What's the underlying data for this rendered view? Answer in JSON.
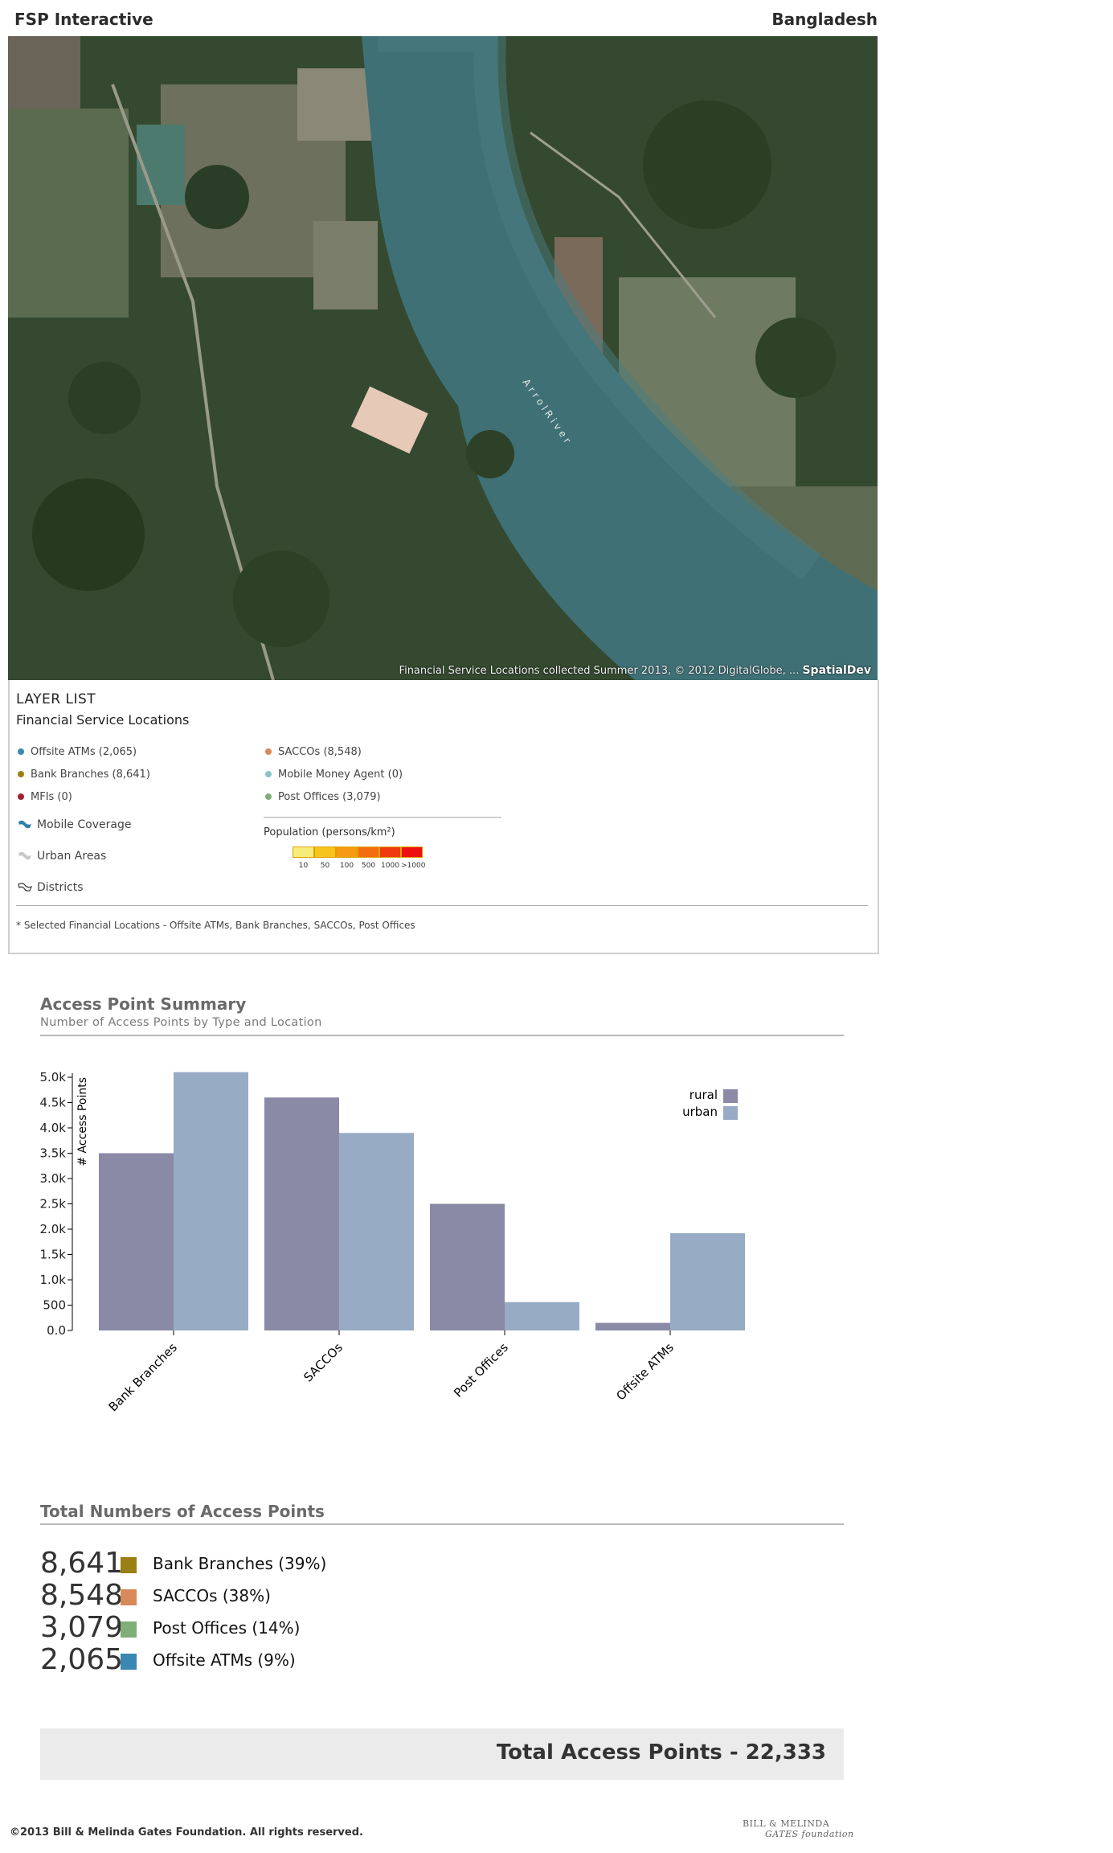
{
  "header": {
    "app_title": "FSP Interactive",
    "country": "Bangladesh"
  },
  "map": {
    "river_label": "A r r o l   R i v e r",
    "attribution": "Financial Service Locations collected Summer 2013, © 2012 DigitalGlobe, ...",
    "brand": "SpatialDev"
  },
  "layer_list": {
    "title": "LAYER LIST",
    "subtitle": "Financial Service Locations",
    "items": [
      {
        "label": "Offsite ATMs (2,065)",
        "color": "#3a87b3"
      },
      {
        "label": "Bank Branches (8,641)",
        "color": "#9a7f12"
      },
      {
        "label": "MFIs (0)",
        "color": "#a4202f"
      },
      {
        "label": "SACCOs (8,548)",
        "color": "#d8895a"
      },
      {
        "label": "Mobile Money Agent (0)",
        "color": "#8cc1c9"
      },
      {
        "label": "Post Offices (3,079)",
        "color": "#7fae77"
      }
    ],
    "overlays": [
      {
        "label": "Mobile Coverage",
        "icon": "mobile-coverage-icon"
      },
      {
        "label": "Urban Areas",
        "icon": "urban-areas-icon"
      },
      {
        "label": "Districts",
        "icon": "districts-icon"
      }
    ],
    "population": {
      "label": "Population (persons/km²)",
      "classes": [
        "10",
        "50",
        "100",
        "500",
        "1000",
        ">1000"
      ],
      "colors": [
        "#f7ec7a",
        "#f6c41a",
        "#f59a12",
        "#f36c10",
        "#ef3a10",
        "#ec1010"
      ]
    },
    "footnote": "* Selected Financial Locations - Offsite ATMs, Bank Branches, SACCOs, Post Offices"
  },
  "access_summary": {
    "title": "Access Point Summary",
    "subtitle": "Number of Access Points by Type and Location"
  },
  "chart_data": {
    "type": "bar",
    "categories": [
      "Bank Branches",
      "SACCOs",
      "Post Offices",
      "Offsite ATMs"
    ],
    "series": [
      {
        "name": "rural",
        "color": "#8a89a6",
        "values": [
          3500,
          4600,
          2500,
          150
        ]
      },
      {
        "name": "urban",
        "color": "#98abc5",
        "values": [
          5100,
          3900,
          560,
          1920
        ]
      }
    ],
    "ylabel": "# Access Points",
    "yticks": [
      "0.0",
      "500",
      "1.0k",
      "1.5k",
      "2.0k",
      "2.5k",
      "3.0k",
      "3.5k",
      "4.0k",
      "4.5k",
      "5.0k"
    ],
    "ylim": [
      0,
      5000
    ],
    "legend": "top-right",
    "grid": false
  },
  "totals": {
    "title": "Total Numbers of Access Points",
    "items": [
      {
        "value": "8,641",
        "label": "Bank Branches (39%)",
        "color": "#9a7f12"
      },
      {
        "value": "8,548",
        "label": "SACCOs (38%)",
        "color": "#d8895a"
      },
      {
        "value": "3,079",
        "label": "Post Offices (14%)",
        "color": "#7fae77"
      },
      {
        "value": "2,065",
        "label": "Offsite ATMs (9%)",
        "color": "#3a87b3"
      }
    ],
    "grand_total": "Total Access Points - 22,333"
  },
  "footer": {
    "copyright": "©2013 Bill & Melinda Gates Foundation. All rights reserved.",
    "logo_line1": "BILL & MELINDA",
    "logo_line2": "GATES foundation"
  }
}
